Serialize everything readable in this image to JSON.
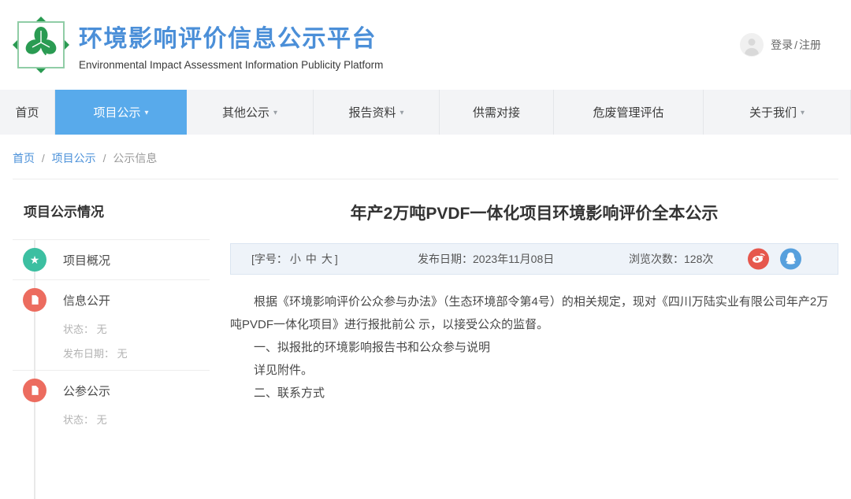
{
  "header": {
    "title": "环境影响评价信息公示平台",
    "subtitle": "Environmental Impact Assessment Information Publicity Platform",
    "login_label": "登录",
    "login_separator": "/",
    "register_label": "注册"
  },
  "icons": {
    "caret": "▾",
    "star": "★",
    "logo": "clover-logo-icon",
    "share": [
      "weibo-icon",
      "qq-icon"
    ],
    "avatar": "user-avatar-icon"
  },
  "nav": {
    "items": [
      {
        "label": "首页",
        "active": false,
        "dropdown": false
      },
      {
        "label": "项目公示",
        "active": true,
        "dropdown": true
      },
      {
        "label": "其他公示",
        "active": false,
        "dropdown": true
      },
      {
        "label": "报告资料",
        "active": false,
        "dropdown": true
      },
      {
        "label": "供需对接",
        "active": false,
        "dropdown": false
      },
      {
        "label": "危废管理评估",
        "active": false,
        "dropdown": false
      },
      {
        "label": "关于我们",
        "active": false,
        "dropdown": true
      }
    ]
  },
  "breadcrumb": {
    "items": [
      "首页",
      "项目公示",
      "公示信息"
    ],
    "separator": "/"
  },
  "sidebar": {
    "title": "项目公示情况",
    "items": [
      {
        "label": "项目概况",
        "icon": "star-icon",
        "color": "#3cbfa1",
        "meta": []
      },
      {
        "label": "信息公开",
        "icon": "document-icon",
        "color": "#ec6c5f",
        "meta": [
          "状态： 无",
          "发布日期： 无"
        ]
      },
      {
        "label": "公参公示",
        "icon": "document-icon",
        "color": "#ec6c5f",
        "meta": [
          "状态： 无"
        ]
      }
    ]
  },
  "article": {
    "title": "年产2万吨PVDF一体化项目环境影响评价全本公示",
    "font_size_prefix": "[字号：",
    "font_sizes": [
      "小",
      "中",
      "大"
    ],
    "font_size_suffix": "]",
    "publish_date": "发布日期：2023年11月08日",
    "views": "浏览次数：128次",
    "paragraphs": [
      "根据《环境影响评价公众参与办法》（生态环境部令第4号）的相关规定，现对《四川万陆实业有限公司年产2万吨PVDF一体化项目》进行报批前公 示，以接受公众的监督。",
      "一、拟报批的环境影响报告书和公众参与说明",
      "详见附件。",
      "二、联系方式"
    ]
  },
  "colors": {
    "brand_blue": "#4b8fd8",
    "nav_active": "#58aaeb",
    "link_blue": "#4a90d9",
    "timeline_green": "#3cbfa1",
    "timeline_red": "#ec6c5f",
    "weibo_red": "#e6574d",
    "qq_blue": "#57a0dd",
    "info_bar_bg": "#eef3f9"
  }
}
